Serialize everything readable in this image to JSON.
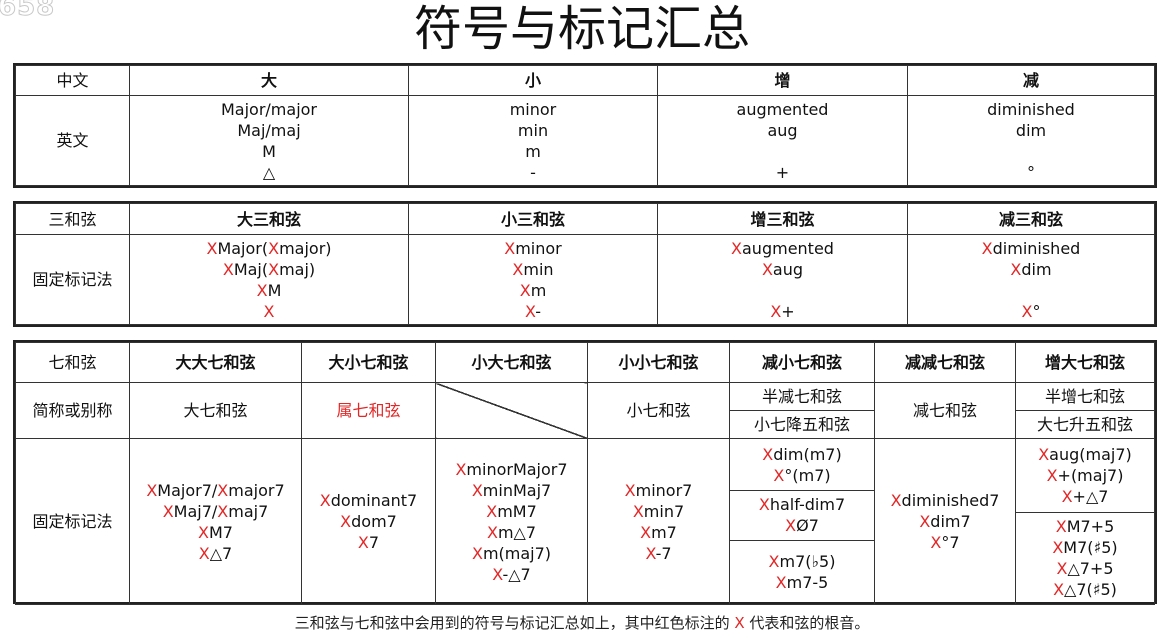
{
  "watermark": "658",
  "title": "符号与标记汇总",
  "table1": {
    "header": [
      "中文",
      "大",
      "小",
      "增",
      "减"
    ],
    "row_label": "英文",
    "cells": [
      [
        "Major/major",
        "Maj/maj",
        "M",
        "△"
      ],
      [
        "minor",
        "min",
        "m",
        "-"
      ],
      [
        "augmented",
        "aug",
        "",
        "+"
      ],
      [
        "diminished",
        "dim",
        "",
        "°"
      ]
    ]
  },
  "table2": {
    "header": [
      "三和弦",
      "大三和弦",
      "小三和弦",
      "增三和弦",
      "减三和弦"
    ],
    "row_label": "固定标记法",
    "root": "X",
    "cells": [
      [
        "Major(",
        "major)",
        "Maj(",
        "maj)",
        "M",
        ""
      ],
      [
        "minor",
        "min",
        "m",
        "-"
      ],
      [
        "augmented",
        "aug",
        "",
        "+"
      ],
      [
        "diminished",
        "dim",
        "",
        "°"
      ]
    ]
  },
  "table3": {
    "header": [
      "七和弦",
      "大大七和弦",
      "大小七和弦",
      "小大七和弦",
      "小小七和弦",
      "减小七和弦",
      "减减七和弦",
      "增大七和弦"
    ],
    "alias_label": "简称或别称",
    "alias": {
      "maj7": "大七和弦",
      "dom7": "属七和弦",
      "min7": "小七和弦",
      "halfdim_1": "半减七和弦",
      "halfdim_2": "小七降五和弦",
      "dim7": "减七和弦",
      "aug_1": "半增七和弦",
      "aug_2": "大七升五和弦"
    },
    "notation_label": "固定标记法",
    "root": "X",
    "maj7": [
      "Major7/",
      "major7",
      "Maj7/",
      "maj7",
      "M7",
      "△7"
    ],
    "dom7": [
      "dominant7",
      "dom7",
      "7"
    ],
    "minmaj7": [
      "minorMajor7",
      "minMaj7",
      "mM7",
      "m△7",
      "m(maj7)",
      "-△7"
    ],
    "min7": [
      "minor7",
      "min7",
      "m7",
      "-7"
    ],
    "halfdim": {
      "a": [
        "dim(m7)",
        "°(m7)"
      ],
      "b": [
        "half-dim7",
        "Ø7"
      ],
      "c": [
        "m7(♭5)",
        "m7-5"
      ]
    },
    "dim7": [
      "diminished7",
      "dim7",
      "°7"
    ],
    "aug": {
      "a": [
        "aug(maj7)",
        "+(maj7)",
        "+△7"
      ],
      "b": [
        "M7+5",
        "M7(♯5)",
        "△7+5",
        "△7(♯5)"
      ]
    }
  },
  "caption": {
    "before": "三和弦与七和弦中会用到的符号与标记汇总如上，其中红色标注的 ",
    "root": "X",
    "after": " 代表和弦的根音。"
  }
}
